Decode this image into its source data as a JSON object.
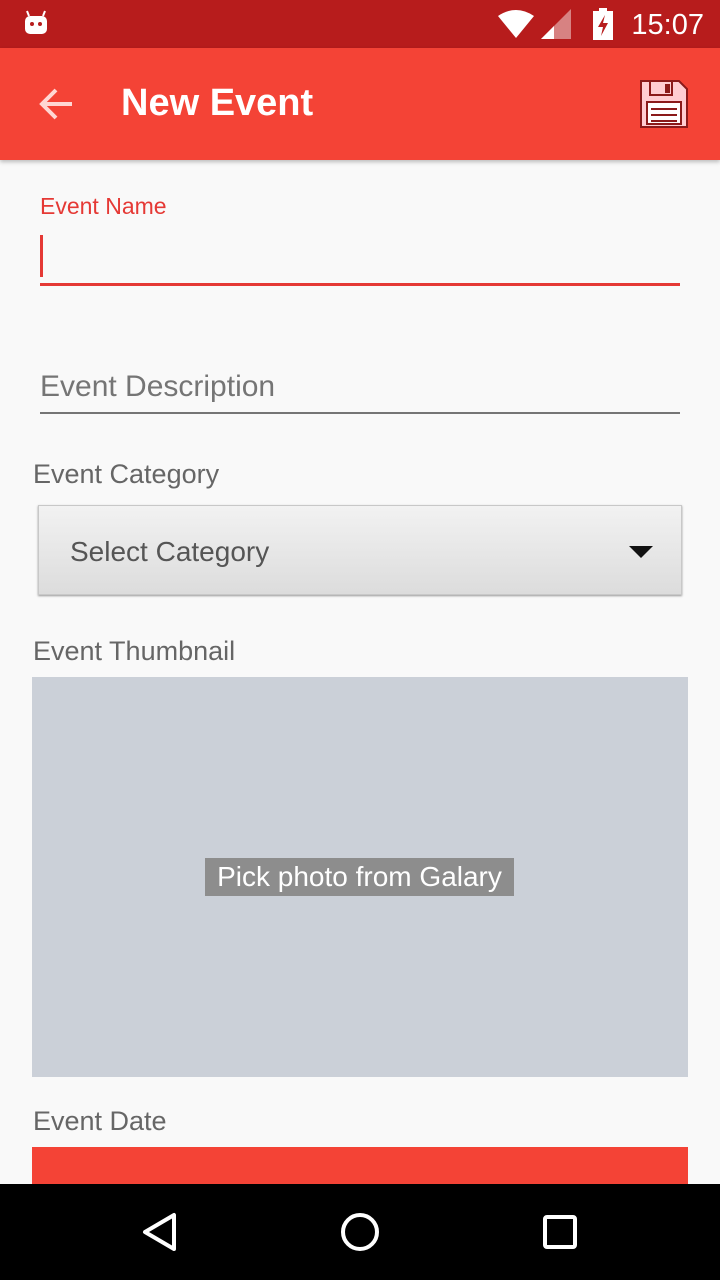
{
  "status_bar": {
    "time": "15:07",
    "icons": [
      "android-icon",
      "wifi-icon",
      "signal-icon",
      "battery-charging-icon"
    ]
  },
  "app_bar": {
    "title": "New Event",
    "back_icon": "arrow-left-icon",
    "save_icon": "floppy-disk-icon"
  },
  "form": {
    "event_name": {
      "label": "Event Name",
      "value": ""
    },
    "event_description": {
      "placeholder": "Event Description",
      "value": ""
    },
    "event_category": {
      "label": "Event Category",
      "selected": "Select Category"
    },
    "event_thumbnail": {
      "label": "Event Thumbnail",
      "button_label": "Pick photo from Galary"
    },
    "event_date": {
      "label": "Event Date"
    }
  },
  "nav_bar": {
    "icons": [
      "back-triangle-icon",
      "home-circle-icon",
      "recents-square-icon"
    ]
  },
  "colors": {
    "primary": "#f44336",
    "primary_dark": "#b71c1c",
    "accent": "#e53935"
  }
}
